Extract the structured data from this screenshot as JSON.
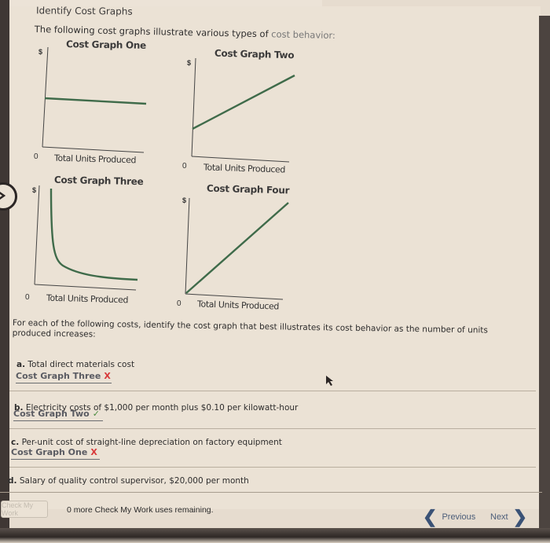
{
  "page": {
    "title": "Identify Cost Graphs",
    "intro_main": "The following cost graphs illustrate various types of ",
    "intro_tail": "cost behavior:"
  },
  "graphs": [
    {
      "title": "Cost Graph One",
      "y_label": "$",
      "origin_label": "0",
      "x_label": "Total Units Produced",
      "shape": "fixed-horizontal"
    },
    {
      "title": "Cost Graph Two",
      "y_label": "$",
      "origin_label": "0",
      "x_label": "Total Units Produced",
      "shape": "mixed-intercept-slope"
    },
    {
      "title": "Cost Graph Three",
      "y_label": "$",
      "origin_label": "0",
      "x_label": "Total Units Produced",
      "shape": "decreasing-curve"
    },
    {
      "title": "Cost Graph Four",
      "y_label": "$",
      "origin_label": "0",
      "x_label": "Total Units Produced",
      "shape": "variable-through-origin"
    }
  ],
  "colors": {
    "line": "#3f6b4a",
    "wrong": "#d8393a",
    "correct": "#4a8c3e",
    "nav": "#3a5276"
  },
  "instructions": "For each of the following costs, identify the cost graph that best illustrates its cost behavior as the number of units produced increases:",
  "questions": [
    {
      "letter": "a.",
      "text": "Total direct materials cost",
      "answer": "Cost Graph Three",
      "mark": "X",
      "status": "incorrect"
    },
    {
      "letter": "b.",
      "text": "Electricity costs of $1,000 per month plus $0.10 per kilowatt-hour",
      "answer": "Cost Graph Two",
      "mark": "✓",
      "status": "correct"
    },
    {
      "letter": "c.",
      "text": "Per-unit cost of straight-line depreciation on factory equipment",
      "answer": "Cost Graph One",
      "mark": "X",
      "status": "incorrect"
    },
    {
      "letter": "d.",
      "text": "Salary of quality control supervisor, $20,000 per month",
      "answer": "",
      "mark": "",
      "status": "unanswered"
    }
  ],
  "footer": {
    "check_button": "Check My Work",
    "remaining_text": "0 more Check My Work uses remaining.",
    "previous": "Previous",
    "next": "Next",
    "previous_icon": "chevron-left-icon",
    "next_icon": "chevron-right-icon"
  }
}
